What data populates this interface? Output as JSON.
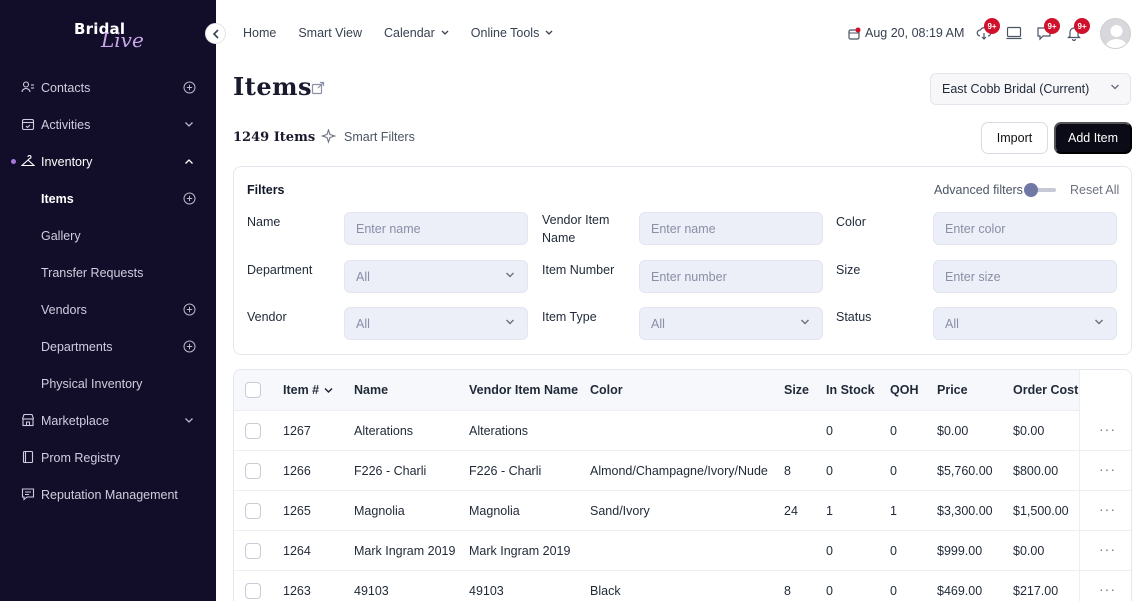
{
  "brand": {
    "word1": "Bridal",
    "word2": "Live"
  },
  "sidebar": {
    "items": [
      {
        "label": "Contacts",
        "icon": "contacts-icon",
        "trail": "plus"
      },
      {
        "label": "Activities",
        "icon": "calendar-icon",
        "trail": "chevron-down"
      },
      {
        "label": "Inventory",
        "icon": "hanger-icon",
        "trail": "chevron-up",
        "active": true
      },
      {
        "label": "Items",
        "sub": true,
        "current": true,
        "trail": "plus"
      },
      {
        "label": "Gallery",
        "sub": true
      },
      {
        "label": "Transfer Requests",
        "sub": true
      },
      {
        "label": "Vendors",
        "sub": true,
        "trail": "plus"
      },
      {
        "label": "Departments",
        "sub": true,
        "trail": "plus"
      },
      {
        "label": "Physical Inventory",
        "sub": true
      },
      {
        "label": "Marketplace",
        "icon": "store-icon",
        "trail": "chevron-down"
      },
      {
        "label": "Prom Registry",
        "icon": "registry-icon"
      },
      {
        "label": "Reputation Management",
        "icon": "review-icon"
      }
    ]
  },
  "topnav": {
    "home": "Home",
    "smart_view": "Smart View",
    "calendar": "Calendar",
    "online_tools": "Online Tools"
  },
  "topbar": {
    "datetime": "Aug 20, 08:19 AM",
    "badge_1": "9+",
    "badge_2": "9+",
    "badge_3": "9+"
  },
  "page": {
    "title": "Items",
    "store": "East Cobb Bridal (Current)",
    "count": "1249 Items",
    "smart_filters": "Smart Filters",
    "import": "Import",
    "add_item": "Add Item"
  },
  "filters": {
    "title": "Filters",
    "advanced": "Advanced filters",
    "advanced_on": false,
    "reset": "Reset All",
    "name_label": "Name",
    "name_ph": "Enter name",
    "vendor_item_name_label_1": "Vendor Item",
    "vendor_item_name_label_2": "Name",
    "vendor_item_name_ph": "Enter name",
    "color_label": "Color",
    "color_ph": "Enter color",
    "department_label": "Department",
    "department_value": "All",
    "item_number_label": "Item Number",
    "item_number_ph": "Enter number",
    "size_label": "Size",
    "size_ph": "Enter size",
    "vendor_label": "Vendor",
    "vendor_value": "All",
    "item_type_label": "Item Type",
    "item_type_value": "All",
    "status_label": "Status",
    "status_value": "All"
  },
  "table": {
    "columns": {
      "item_no": "Item #",
      "name": "Name",
      "vendor_item_name": "Vendor Item Name",
      "color": "Color",
      "size": "Size",
      "in_stock": "In Stock",
      "qoh": "QOH",
      "price": "Price",
      "order_cost": "Order Cost"
    },
    "rows": [
      {
        "item_no": "1267",
        "name": "Alterations",
        "vendor_item_name": "Alterations",
        "color": "",
        "size": "",
        "in_stock": "0",
        "qoh": "0",
        "price": "$0.00",
        "order_cost": "$0.00"
      },
      {
        "item_no": "1266",
        "name": "F226 - Charli",
        "vendor_item_name": "F226 - Charli",
        "color": "Almond/Champagne/Ivory/Nude",
        "size": "8",
        "in_stock": "0",
        "qoh": "0",
        "price": "$5,760.00",
        "order_cost": "$800.00"
      },
      {
        "item_no": "1265",
        "name": "Magnolia",
        "vendor_item_name": "Magnolia",
        "color": "Sand/Ivory",
        "size": "24",
        "in_stock": "1",
        "qoh": "1",
        "price": "$3,300.00",
        "order_cost": "$1,500.00"
      },
      {
        "item_no": "1264",
        "name": "Mark Ingram 2019",
        "vendor_item_name": "Mark Ingram 2019",
        "color": "",
        "size": "",
        "in_stock": "0",
        "qoh": "0",
        "price": "$999.00",
        "order_cost": "$0.00"
      },
      {
        "item_no": "1263",
        "name": "49103",
        "vendor_item_name": "49103",
        "color": "Black",
        "size": "8",
        "in_stock": "0",
        "qoh": "0",
        "price": "$469.00",
        "order_cost": "$217.00"
      }
    ],
    "row_actions": "···"
  }
}
